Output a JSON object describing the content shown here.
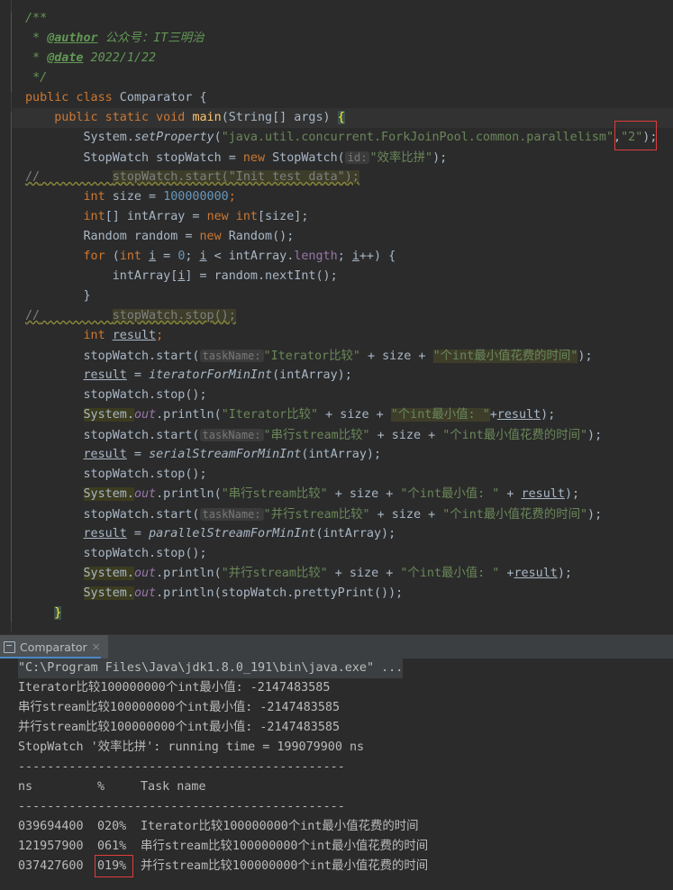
{
  "code": {
    "doc_open": "/**",
    "author_tag": "@author",
    "author_value": " 公众号：IT三明治",
    "date_tag": "@date",
    "date_value": " 2022/1/22",
    "doc_close": "*/",
    "class_kw": "public class",
    "class_name": " Comparator {",
    "main_kw": "public static void",
    "main_name": "main",
    "main_params": "(String[] args) ",
    "main_brace": "{",
    "l1_obj": "System.",
    "l1_method": "setProperty",
    "l1_arg1": "\"java.util.concurrent.ForkJoinPool.common.parallelism\"",
    "l1_comma": ",",
    "l1_arg2": "\"2\"",
    "l1_end": ");",
    "l2_a": "StopWatch stopWatch = ",
    "l2_new": "new",
    "l2_b": " StopWatch(",
    "l2_hint": "id:",
    "l2_str": "\"效率比拼\"",
    "l2_end": ");",
    "l3_cmt": "//",
    "l3_code": "stopWatch.start(\"Init test data\");",
    "l4_type": "int",
    "l4_a": " size = ",
    "l4_num": "100000000",
    "l4_end": ";",
    "l5_type": "int",
    "l5_a": "[] intArray = ",
    "l5_new": "new",
    "l5_type2": " int",
    "l5_b": "[size];",
    "l6_a": "Random random = ",
    "l6_new": "new",
    "l6_b": " Random();",
    "l7_for": "for",
    "l7_a": " (",
    "l7_int": "int",
    "l7_i1": "i",
    "l7_b": " = ",
    "l7_zero": "0",
    "l7_c": "; ",
    "l7_i2": "i",
    "l7_d": " < intArray.",
    "l7_len": "length",
    "l7_e": "; ",
    "l7_i3": "i",
    "l7_f": "++) {",
    "l8_a": "intArray[",
    "l8_i": "i",
    "l8_b": "] = random.nextInt();",
    "l9": "}",
    "l10_cmt": "//",
    "l10_code": "stopWatch.stop();",
    "l11_type": "int",
    "l11_var": "result",
    "l11_end": ";",
    "l12_a": "stopWatch.start(",
    "l12_hint": "taskName:",
    "l12_str": "\"Iterator比较\"",
    "l12_b": " + size + ",
    "l12_str2": "\"个int最小值花费的时间\"",
    "l12_end": ");",
    "l13_var": "result",
    "l13_a": " = ",
    "l13_fn": "iteratorForMinInt",
    "l13_b": "(intArray);",
    "l14": "stopWatch.stop();",
    "l15_sys": "System.",
    "l15_out": "out",
    "l15_a": ".println(",
    "l15_str": "\"Iterator比较\"",
    "l15_b": " + size + ",
    "l15_str2": "\"个int最小值: \"",
    "l15_c": "+",
    "l15_var": "result",
    "l15_end": ");",
    "l16_a": "stopWatch.start(",
    "l16_hint": "taskName:",
    "l16_str": "\"串行stream比较\"",
    "l16_b": " + size + ",
    "l16_str2": "\"个int最小值花费的时间\"",
    "l16_end": ");",
    "l17_var": "result",
    "l17_a": " = ",
    "l17_fn": "serialStreamForMinInt",
    "l17_b": "(intArray);",
    "l18": "stopWatch.stop();",
    "l19_sys": "System.",
    "l19_out": "out",
    "l19_a": ".println(",
    "l19_str": "\"串行stream比较\"",
    "l19_b": " + size + ",
    "l19_str2": "\"个int最小值: \"",
    "l19_c": " + ",
    "l19_var": "result",
    "l19_end": ");",
    "l20_a": "stopWatch.start(",
    "l20_hint": "taskName:",
    "l20_str": "\"并行stream比较\"",
    "l20_b": " + size + ",
    "l20_str2": "\"个int最小值花费的时间\"",
    "l20_end": ");",
    "l21_var": "result",
    "l21_a": " = ",
    "l21_fn": "parallelStreamForMinInt",
    "l21_b": "(intArray);",
    "l22": "stopWatch.stop();",
    "l23_sys": "System.",
    "l23_out": "out",
    "l23_a": ".println(",
    "l23_str": "\"并行stream比较\"",
    "l23_b": " + size + ",
    "l23_str2": "\"个int最小值: \"",
    "l23_c": " +",
    "l23_var": "result",
    "l23_end": ");",
    "l24_sys": "System.",
    "l24_out": "out",
    "l24_a": ".println(stopWatch.prettyPrint());",
    "close_brace": "}"
  },
  "run_panel": {
    "tab_label": "Comparator",
    "tab_close": "×"
  },
  "console": {
    "cmd": "\"C:\\Program Files\\Java\\jdk1.8.0_191\\bin\\java.exe\" ...",
    "out1": "Iterator比较100000000个int最小值: -2147483585",
    "out2": "串行stream比较100000000个int最小值: -2147483585",
    "out3": "并行stream比较100000000个int最小值: -2147483585",
    "out4": "StopWatch '效率比拼': running time = 199079900 ns",
    "sep1": "---------------------------------------------",
    "hdr_ns": "ns",
    "hdr_pct": "%",
    "hdr_task": "Task name",
    "sep2": "---------------------------------------------",
    "rows": [
      {
        "ns": "039694400",
        "pct": "020%",
        "task": "Iterator比较100000000个int最小值花费的时间"
      },
      {
        "ns": "121957900",
        "pct": "061%",
        "task": "串行stream比较100000000个int最小值花费的时间"
      },
      {
        "ns": "037427600",
        "pct": "019%",
        "task": "并行stream比较100000000个int最小值花费的时间"
      }
    ]
  },
  "colors": {
    "background": "#2b2b2b",
    "keyword": "#cc7832",
    "string": "#6a8759",
    "number": "#6897bb",
    "method": "#ffc66d",
    "field": "#9876aa",
    "highlight_box": "#e03c3c"
  }
}
